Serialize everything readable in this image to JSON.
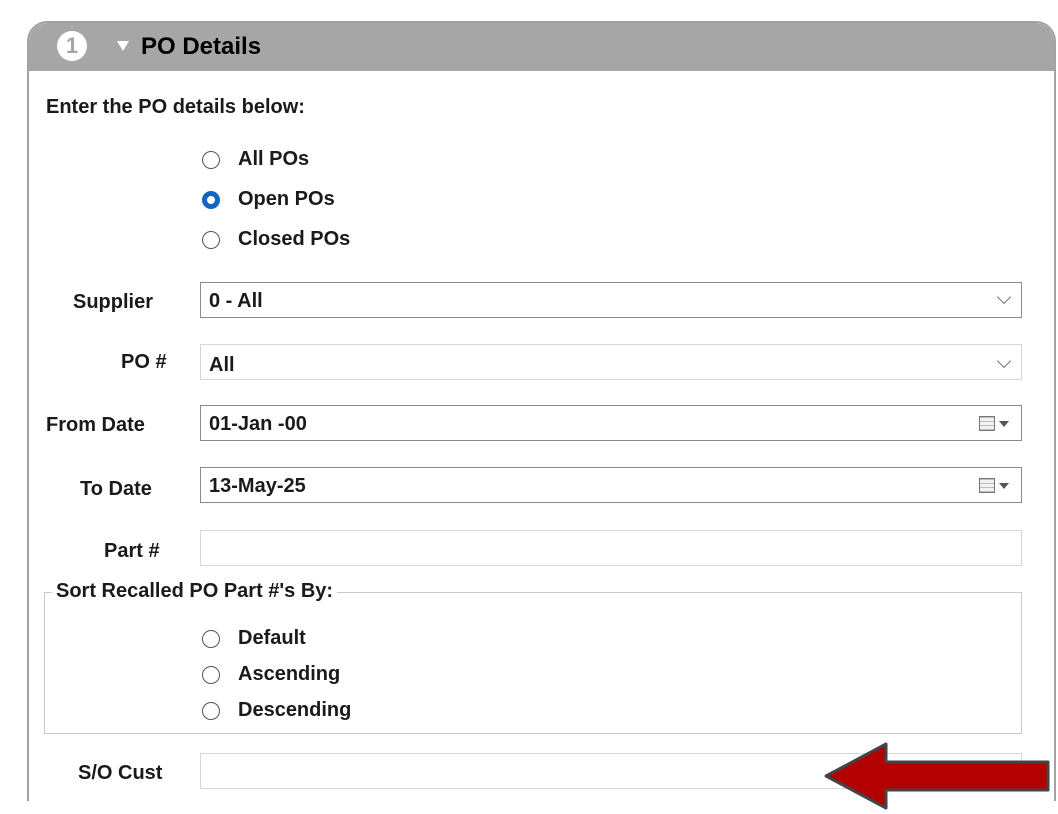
{
  "panel": {
    "step_number": "1",
    "title": "PO Details",
    "intro": "Enter the PO details below:"
  },
  "po_status": {
    "options": [
      {
        "label": "All POs",
        "checked": false
      },
      {
        "label": "Open POs",
        "checked": true
      },
      {
        "label": "Closed POs",
        "checked": false
      }
    ]
  },
  "fields": {
    "supplier": {
      "label": "Supplier",
      "value": "0 - All"
    },
    "po_number": {
      "label": "PO #",
      "value": "All"
    },
    "from_date": {
      "label": "From Date",
      "value": "01-Jan -00"
    },
    "to_date": {
      "label": "To Date",
      "value": "13-May-25"
    },
    "part_number": {
      "label": "Part #",
      "value": ""
    },
    "so_cust": {
      "label": "S/O Cust",
      "value": ""
    }
  },
  "sort": {
    "legend": "Sort Recalled PO Part #'s By:",
    "options": [
      {
        "label": "Default",
        "checked": false
      },
      {
        "label": "Ascending",
        "checked": false
      },
      {
        "label": "Descending",
        "checked": false
      }
    ]
  },
  "colors": {
    "header_bg": "#a6a6a6",
    "radio_checked": "#1565c0",
    "annotation_arrow": "#b30000"
  },
  "icons": [
    "step-number-icon",
    "collapse-triangle-icon",
    "chevron-down-icon",
    "calendar-icon",
    "annotation-arrow-icon"
  ]
}
